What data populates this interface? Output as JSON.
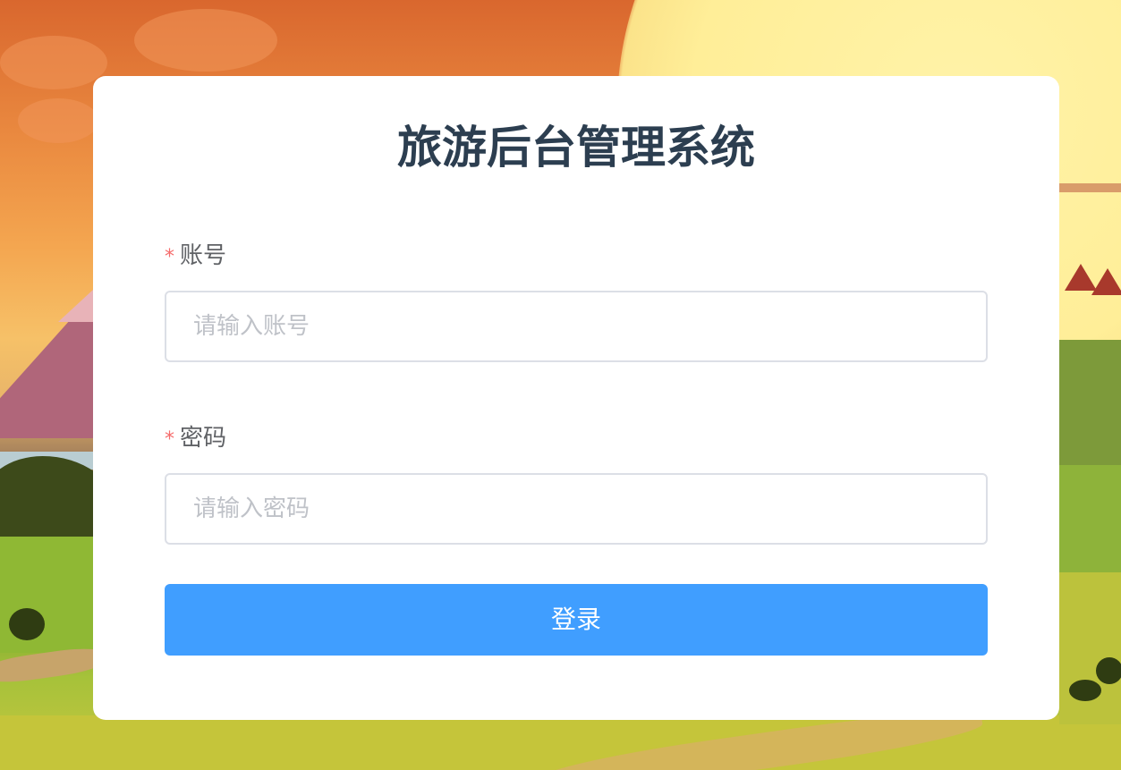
{
  "login": {
    "title": "旅游后台管理系统",
    "account": {
      "required_mark": "*",
      "label": "账号",
      "placeholder": "请输入账号",
      "value": ""
    },
    "password": {
      "required_mark": "*",
      "label": "密码",
      "placeholder": "请输入密码",
      "value": ""
    },
    "submit_label": "登录"
  },
  "colors": {
    "primary": "#409eff",
    "required": "#f56c6c",
    "title": "#2c3e50",
    "label": "#606266",
    "border": "#dcdfe6"
  }
}
